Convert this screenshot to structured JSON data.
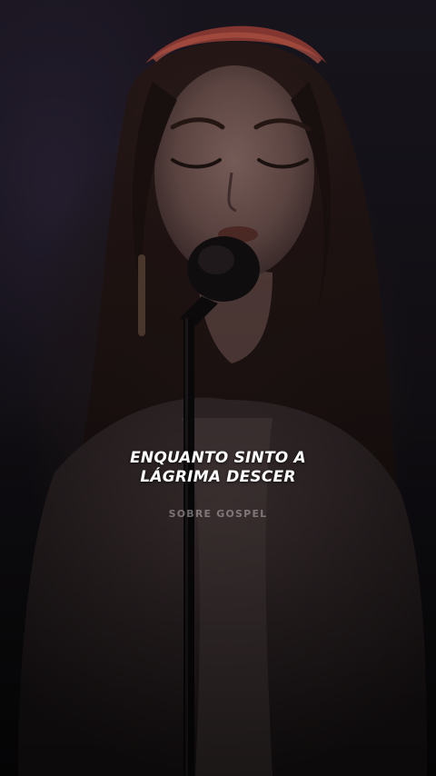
{
  "lyric": {
    "line1": "ENQUANTO SINTO A",
    "line2": "LÁGRIMA DESCER"
  },
  "brand": {
    "label": "SOBRE GOSPEL"
  },
  "scene": {
    "background_color": "#0d0b0e",
    "headband_color": "#a8443a",
    "hair_color": "#1c1210",
    "skin_color": "#7a5a55"
  }
}
